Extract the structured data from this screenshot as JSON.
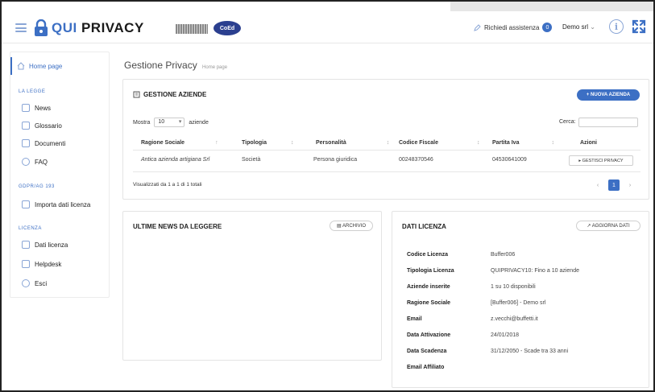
{
  "header": {
    "logo_qui": "QUI",
    "logo_privacy": "PRIVACY",
    "partner_badge": "CoEd",
    "assistance_label": "Richiedi assistenza",
    "assistance_count": "0",
    "user_label": "Demo srl",
    "user_chevron": "⌄",
    "info_glyph": "i"
  },
  "sidebar": {
    "home_label": "Home page",
    "section_legge": "LA LEGGE",
    "items_legge": [
      {
        "label": "News",
        "icon": "rss-icon"
      },
      {
        "label": "Glossario",
        "icon": "book-icon"
      },
      {
        "label": "Documenti",
        "icon": "folder-icon"
      },
      {
        "label": "FAQ",
        "icon": "help-icon"
      }
    ],
    "section_gdpr": "GDPR/AG 193",
    "items_gdpr": [
      {
        "label": "Importa dati licenza",
        "icon": "import-icon"
      }
    ],
    "section_licenza": "LICENZA",
    "items_licenza": [
      {
        "label": "Dati licenza",
        "icon": "edit-icon"
      },
      {
        "label": "Helpdesk",
        "icon": "wrench-icon"
      },
      {
        "label": "Esci",
        "icon": "logout-icon"
      }
    ]
  },
  "page": {
    "title": "Gestione Privacy",
    "breadcrumb": "Home page"
  },
  "aziende": {
    "heading": "GESTIONE AZIENDE",
    "new_button": "+ NUOVA AZIENDA",
    "show_prefix": "Mostra",
    "show_value": "10",
    "show_suffix": "aziende",
    "search_label": "Cerca:",
    "search_value": "",
    "columns": [
      "Ragione Sociale",
      "Tipologia",
      "Personalità",
      "Codice Fiscale",
      "Partita Iva",
      "Azioni"
    ],
    "rows": [
      {
        "ragione_sociale": "Antica azienda artigiana Srl",
        "tipologia": "Società",
        "personalita": "Persona giuridica",
        "codice_fiscale": "00248370546",
        "partita_iva": "04530641009",
        "action_label": "▸ GESTISCI PRIVACY"
      }
    ],
    "footer_info": "Visualizzati da 1 a 1 di 1 totali",
    "pager": {
      "prev": "‹",
      "current": "1",
      "next": "›"
    }
  },
  "news": {
    "heading": "ULTIME NEWS DA LEGGERE",
    "archive_button": "▤ ARCHIVIO"
  },
  "license": {
    "heading": "DATI LICENZA",
    "update_button": "↗ AGGIORNA DATI",
    "fields": [
      {
        "label": "Codice Licenza",
        "value": "Buffer006"
      },
      {
        "label": "Tipologia Licenza",
        "value": "QUIPRIVACY10: Fino a 10 aziende"
      },
      {
        "label": "Aziende inserite",
        "value": "1 su 10 disponibili"
      },
      {
        "label": "Ragione Sociale",
        "value": "[Buffer006] - Demo srl"
      },
      {
        "label": "Email",
        "value": "z.vecchi@buffetti.it"
      },
      {
        "label": "Data Attivazione",
        "value": "24/01/2018"
      },
      {
        "label": "Data Scadenza",
        "value": "31/12/2050 - Scade tra 33 anni"
      },
      {
        "label": "Email Affiliato",
        "value": ""
      }
    ]
  },
  "colors": {
    "accent": "#3c6fc4",
    "icon_blue": "#8aa6d6"
  }
}
